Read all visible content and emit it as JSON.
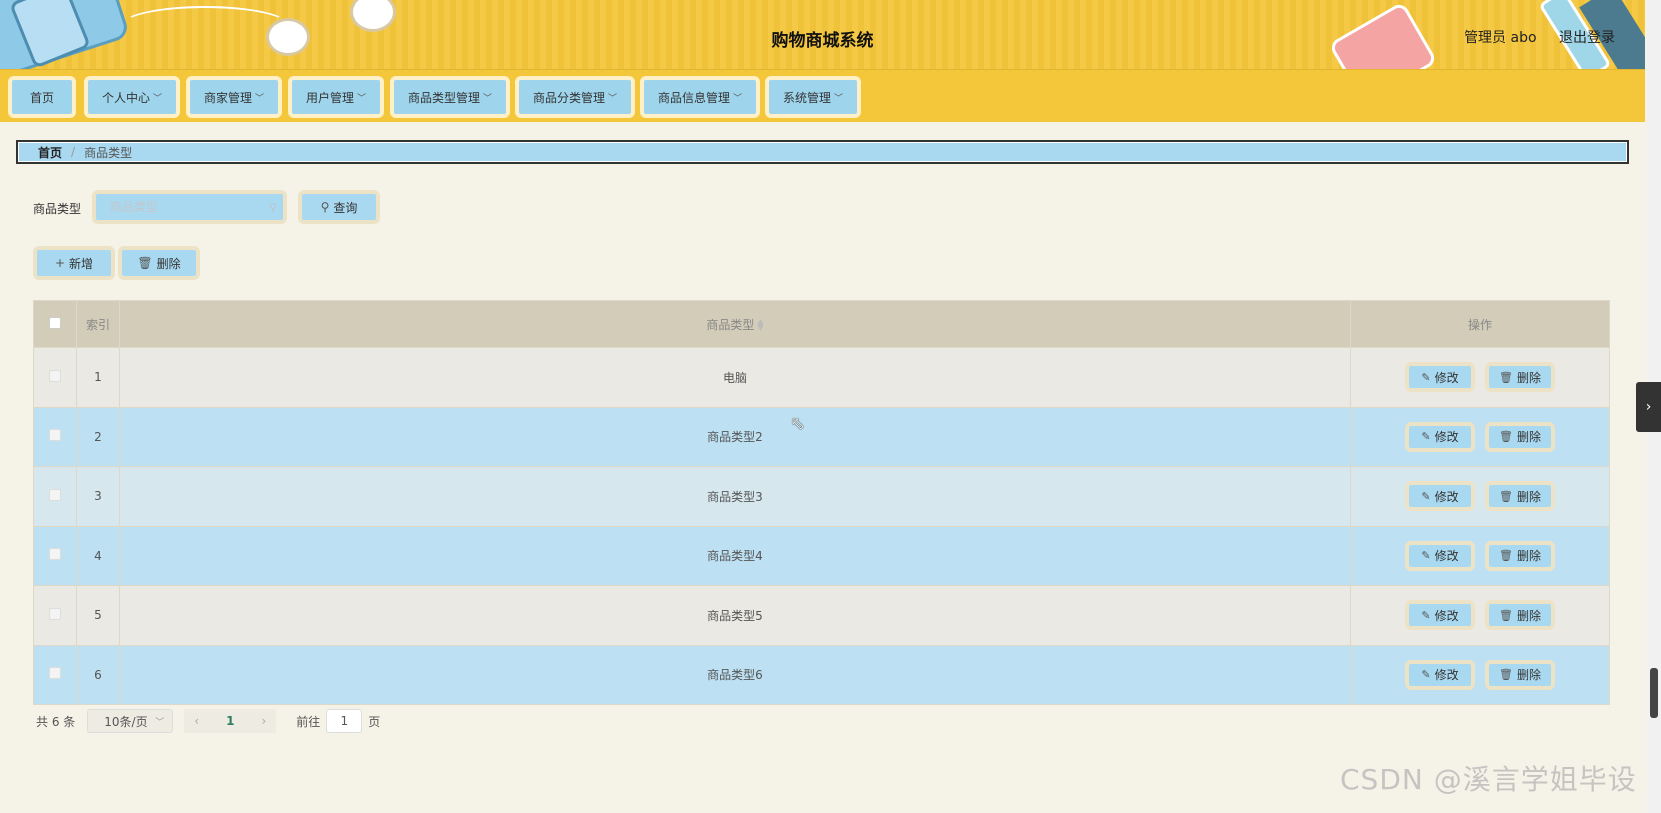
{
  "header": {
    "title": "购物商城系统",
    "user_label": "管理员 abo",
    "logout_label": "退出登录"
  },
  "nav": {
    "items": [
      {
        "label": "首页",
        "has_dropdown": false
      },
      {
        "label": "个人中心",
        "has_dropdown": true
      },
      {
        "label": "商家管理",
        "has_dropdown": true
      },
      {
        "label": "用户管理",
        "has_dropdown": true
      },
      {
        "label": "商品类型管理",
        "has_dropdown": true
      },
      {
        "label": "商品分类管理",
        "has_dropdown": true
      },
      {
        "label": "商品信息管理",
        "has_dropdown": true
      },
      {
        "label": "系统管理",
        "has_dropdown": true
      }
    ]
  },
  "breadcrumb": {
    "home": "首页",
    "separator": "/",
    "current": "商品类型"
  },
  "search": {
    "label": "商品类型",
    "placeholder": "商品类型",
    "value": "",
    "query_button": "查询"
  },
  "actions": {
    "add_button": "新增",
    "delete_button": "删除"
  },
  "table": {
    "columns": {
      "index": "索引",
      "type": "商品类型",
      "ops": "操作"
    },
    "rows": [
      {
        "index": "1",
        "type": "电脑"
      },
      {
        "index": "2",
        "type": "商品类型2"
      },
      {
        "index": "3",
        "type": "商品类型3"
      },
      {
        "index": "4",
        "type": "商品类型4"
      },
      {
        "index": "5",
        "type": "商品类型5"
      },
      {
        "index": "6",
        "type": "商品类型6"
      }
    ],
    "edit_label": "修改",
    "delete_label": "删除"
  },
  "pagination": {
    "total": "共 6 条",
    "page_size": "10条/页",
    "current_page": "1",
    "goto_label": "前往",
    "goto_value": "1",
    "page_unit": "页"
  },
  "watermark": "CSDN @溪言学姐毕设",
  "colors": {
    "header_bg": "#f4c63a",
    "button_bg": "#a9d9f0",
    "button_border": "#ece3c6",
    "table_header_bg": "#d2ccb8",
    "row_blue": "#bde0f2",
    "row_grey": "#ebe9e4"
  }
}
